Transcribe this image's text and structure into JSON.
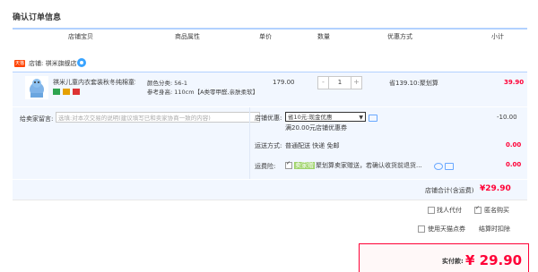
{
  "page": {
    "title": "确认订单信息"
  },
  "table_headers": [
    "店铺宝贝",
    "商品属性",
    "单价",
    "数量",
    "优惠方式",
    "小计"
  ],
  "shop": {
    "name": "店铺: 祺米旗舰店",
    "logo_text": "天猫"
  },
  "item": {
    "name": "祺米儿童内衣套装秋冬纯棉童套...",
    "attr_color": "颜色分类: 56-1",
    "attr_size": "参考身高: 110cm【A类零甲醛,亲肤柔软】",
    "price": "179.00",
    "quantity": "1",
    "minus": "-",
    "plus": "+",
    "discount": "省139.10:聚划算",
    "subtotal": "39.90"
  },
  "order": {
    "memo_label": "给卖家留言:",
    "memo_placeholder": "选填:对本次交易的说明(建议填写已和卖家协商一致的内容)",
    "shop_discount_label": "店铺优惠:",
    "shop_discount_select": "省10元:现金优惠",
    "shop_discount_note": "满20.00元店铺优惠券",
    "shop_discount_value": "-10.00",
    "shipping_label": "运送方式:",
    "shipping_value": "普通配送 快递 免邮",
    "shipping_amount": "0.00",
    "insurance_label": "运费险:",
    "insurance_tag": "卖家赠",
    "insurance_text": "聚划算卖家赠送，若确认收货前退货...",
    "insurance_amount": "0.00",
    "total_label": "店铺合计(含运费)",
    "total_value": "¥29.90"
  },
  "options": {
    "pay_for_me": "找人代付",
    "anonymous": "匿名购买",
    "tmall_points": "使用天猫点券",
    "instant_refund": "结算时扣除"
  },
  "payment": {
    "label": "实付款:",
    "value": "¥ 29.90"
  },
  "colors": {
    "accent": "#ff0036",
    "row_bg": "#f2f7ff",
    "header_line": "#b2d1ff"
  }
}
